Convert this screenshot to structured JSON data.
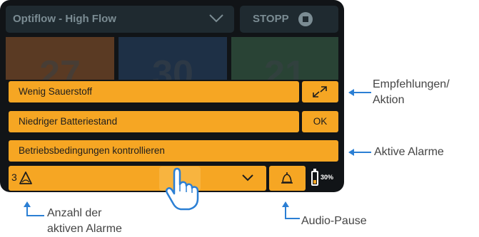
{
  "header": {
    "mode_label": "Optiflow - High Flow",
    "stop_label": "STOPP"
  },
  "tiles": [
    "27",
    "30",
    "21"
  ],
  "alarms": [
    {
      "text": "Wenig Sauerstoff",
      "action": "expand-icon"
    },
    {
      "text": "Niedriger Batteriestand",
      "action_label": "OK"
    },
    {
      "text": "Betriebsbedingungen kontrollieren"
    }
  ],
  "bottom": {
    "alarm_count": "3",
    "battery_percent": "30%",
    "battery_level": 0.3
  },
  "callouts": {
    "recommendations": "Empfehlungen/\nAktion",
    "active_alarms": "Aktive Alarme",
    "alarm_count": "Anzahl der\naktiven Alarme",
    "audio_pause": "Audio-Pause"
  },
  "colors": {
    "accent": "#f6a623",
    "device_bg": "#111417",
    "tile_1": "#5a3a23",
    "tile_2": "#1e3046",
    "tile_3": "#294335"
  }
}
